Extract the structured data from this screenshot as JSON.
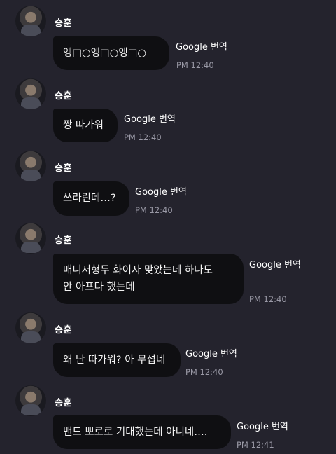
{
  "messages": [
    {
      "sender": "승훈",
      "text": "엥□○엥□○엥□○",
      "translate_label": "Google 번역",
      "time": "PM 12:40"
    },
    {
      "sender": "승훈",
      "text": "짱 따가워",
      "translate_label": "Google 번역",
      "time": "PM 12:40"
    },
    {
      "sender": "승훈",
      "text": "쓰라린데…?",
      "translate_label": "Google 번역",
      "time": "PM 12:40"
    },
    {
      "sender": "승훈",
      "text": "매니저형두 화이자 맞았는데 하나도\n안 아프다 했는데",
      "translate_label": "Google 번역",
      "time": "PM 12:40"
    },
    {
      "sender": "승훈",
      "text": "왜 난 따가워? 아 무섭네",
      "translate_label": "Google 번역",
      "time": "PM 12:40"
    },
    {
      "sender": "승훈",
      "text": "밴드 뽀로로 기대했는데 아니네….",
      "translate_label": "Google 번역",
      "time": "PM 12:41"
    }
  ]
}
